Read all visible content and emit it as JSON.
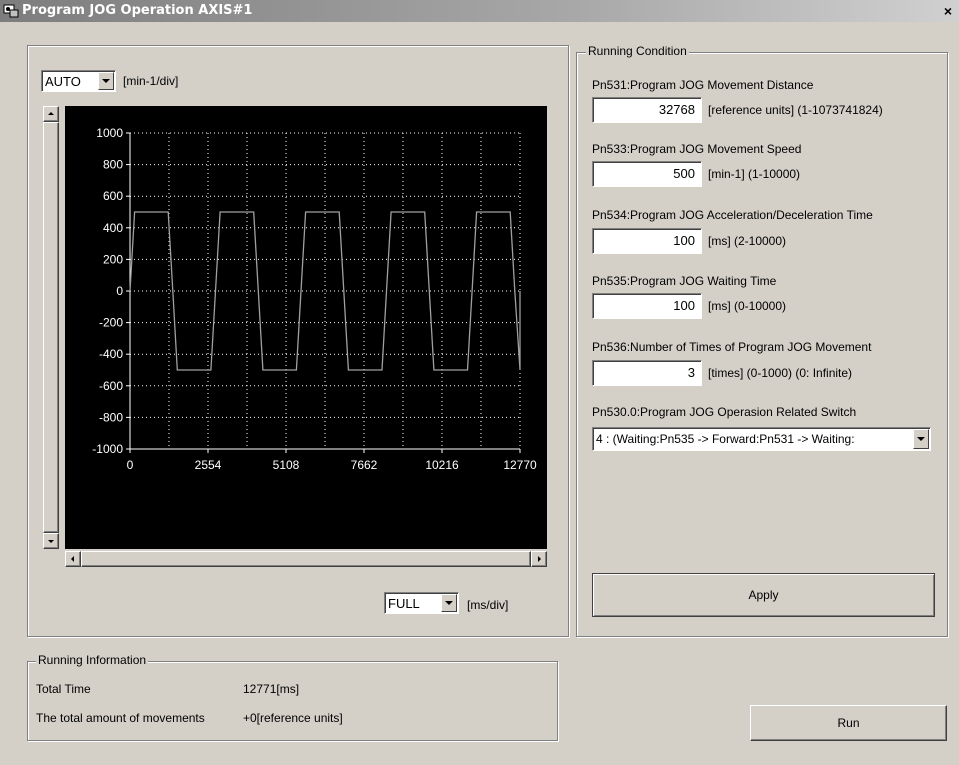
{
  "window": {
    "title": "Program JOG Operation AXIS#1",
    "close": "×"
  },
  "graph": {
    "y_scale": "AUTO",
    "y_unit": "[min-1/div]",
    "x_scale": "FULL",
    "x_unit": "[ms/div]"
  },
  "chart_data": {
    "type": "line",
    "series": [
      {
        "x": [
          0,
          150,
          1250,
          1400,
          1550,
          2650,
          2800,
          2950,
          4050,
          4200,
          4350,
          5450,
          5600,
          5750,
          6850,
          7000,
          7150,
          8250,
          8400,
          8550,
          9650,
          9800,
          9950,
          11050,
          11200,
          11350,
          12450,
          12600,
          12770,
          12770
        ],
        "y": [
          0,
          500,
          500,
          0,
          -500,
          -500,
          0,
          500,
          500,
          0,
          -500,
          -500,
          0,
          500,
          500,
          0,
          -500,
          -500,
          0,
          500,
          500,
          0,
          -500,
          -500,
          0,
          500,
          500,
          0,
          -500,
          0
        ]
      }
    ],
    "y_ticks": [
      "1000",
      "800",
      "600",
      "400",
      "200",
      "0",
      "-200",
      "-400",
      "-600",
      "-800",
      "-1000"
    ],
    "x_ticks": [
      "0",
      "2554",
      "5108",
      "7662",
      "10216",
      "12770"
    ],
    "xlim": [
      0,
      12770
    ],
    "ylim": [
      -1000,
      1000
    ],
    "grid": true,
    "colors": {
      "background": "#000000",
      "line": "#a0a0a0",
      "grid": "#ffffff"
    }
  },
  "running_condition": {
    "label": "Running Condition",
    "params": [
      {
        "label": "Pn531:Program JOG Movement Distance",
        "value": "32768",
        "unit": "[reference units] (1-1073741824)"
      },
      {
        "label": "Pn533:Program JOG Movement Speed",
        "value": "500",
        "unit": "[min-1] (1-10000)"
      },
      {
        "label": "Pn534:Program JOG Acceleration/Deceleration Time",
        "value": "100",
        "unit": "[ms] (2-10000)"
      },
      {
        "label": "Pn535:Program JOG Waiting Time",
        "value": "100",
        "unit": "[ms] (0-10000)"
      },
      {
        "label": "Pn536:Number of Times of Program JOG Movement",
        "value": "3",
        "unit": "[times] (0-1000) (0: Infinite)"
      }
    ],
    "switch_label": "Pn530.0:Program JOG Operasion Related Switch",
    "switch_value": "4 : (Waiting:Pn535 -> Forward:Pn531 -> Waiting:",
    "apply": "Apply"
  },
  "running_info": {
    "label": "Running Information",
    "rows": [
      {
        "label": "Total Time",
        "value": "12771[ms]"
      },
      {
        "label": "The total amount of movements",
        "value": "+0[reference units]"
      }
    ]
  },
  "run": "Run"
}
